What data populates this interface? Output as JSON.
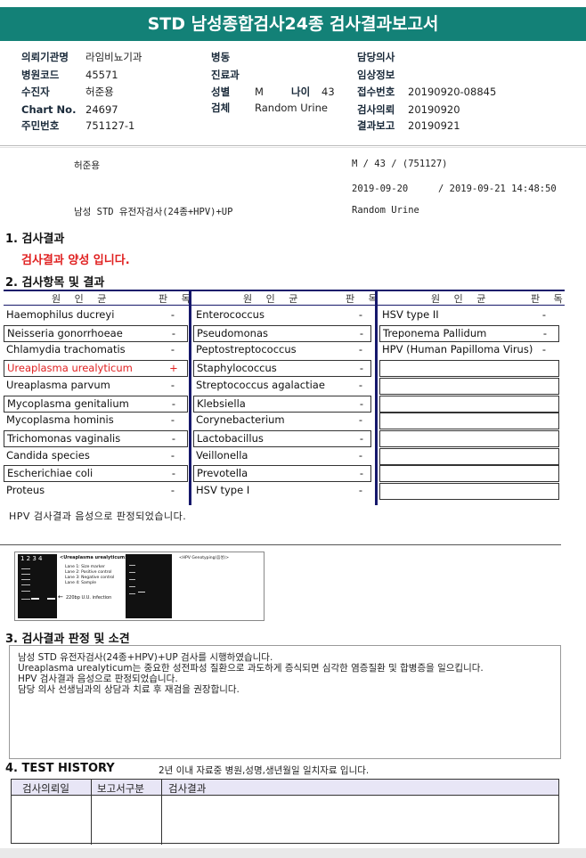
{
  "title": "STD 남성종합검사24종 검사결과보고서",
  "header": {
    "c1": [
      {
        "label": "의뢰기관명",
        "value": "라임비뇨기과"
      },
      {
        "label": "병원코드",
        "value": "45571"
      },
      {
        "label": "수진자",
        "value": "허준용"
      },
      {
        "label": "Chart No.",
        "value": "24697"
      },
      {
        "label": "주민번호",
        "value": "751127-1"
      }
    ],
    "c2": [
      {
        "label": "병동",
        "value": ""
      },
      {
        "label": "진료과",
        "value": ""
      },
      {
        "label": "성별",
        "value": "M"
      },
      {
        "label": "검체",
        "value": "Random Urine"
      }
    ],
    "age_label": "나이",
    "age_value": "43",
    "c3": [
      {
        "label": "담당의사",
        "value": ""
      },
      {
        "label": "임상정보",
        "value": ""
      },
      {
        "label": "접수번호",
        "value": "20190920-08845"
      },
      {
        "label": "검사의뢰",
        "value": "20190920"
      },
      {
        "label": "결과보고",
        "value": "20190921"
      }
    ]
  },
  "summary": {
    "name": "허준용",
    "sex_age": "M /    43 / (751127)",
    "date_from": "2019-09-20",
    "date_to": "/  2019-09-21 14:48:50",
    "test_name": "남성 STD 유전자검사(24종+HPV)+UP",
    "specimen": "Random Urine"
  },
  "section1": {
    "title": "1. 검사결과",
    "result": "검사결과 양성 입니다."
  },
  "section2": {
    "title": "2. 검사항목 및 결과",
    "col_header_name": "원 인 균",
    "col_header_result": "판 독",
    "columns": [
      [
        {
          "name": "Haemophilus ducreyi",
          "result": "-",
          "positive": false
        },
        {
          "name": "Neisseria gonorrhoeae",
          "result": "-",
          "positive": false
        },
        {
          "name": "Chlamydia trachomatis",
          "result": "-",
          "positive": false
        },
        {
          "name": "Ureaplasma urealyticum",
          "result": "+",
          "positive": true
        },
        {
          "name": "Ureaplasma parvum",
          "result": "-",
          "positive": false
        },
        {
          "name": "Mycoplasma genitalium",
          "result": "-",
          "positive": false
        },
        {
          "name": "Mycoplasma hominis",
          "result": "-",
          "positive": false
        },
        {
          "name": "Trichomonas vaginalis",
          "result": "-",
          "positive": false
        },
        {
          "name": "Candida species",
          "result": "-",
          "positive": false
        },
        {
          "name": "Escherichiae coli",
          "result": "-",
          "positive": false
        },
        {
          "name": "Proteus",
          "result": "-",
          "positive": false
        }
      ],
      [
        {
          "name": "Enterococcus",
          "result": "-",
          "positive": false
        },
        {
          "name": "Pseudomonas",
          "result": "-",
          "positive": false
        },
        {
          "name": "Peptostreptococcus",
          "result": "-",
          "positive": false
        },
        {
          "name": "Staphylococcus",
          "result": "-",
          "positive": false
        },
        {
          "name": "Streptococcus agalactiae",
          "result": "-",
          "positive": false
        },
        {
          "name": "Klebsiella",
          "result": "-",
          "positive": false
        },
        {
          "name": "Corynebacterium",
          "result": "-",
          "positive": false
        },
        {
          "name": "Lactobacillus",
          "result": "-",
          "positive": false
        },
        {
          "name": "Veillonella",
          "result": "-",
          "positive": false
        },
        {
          "name": "Prevotella",
          "result": "-",
          "positive": false
        },
        {
          "name": "HSV type I",
          "result": "-",
          "positive": false
        }
      ],
      [
        {
          "name": "HSV type II",
          "result": "-",
          "positive": false
        },
        {
          "name": "Treponema Pallidum",
          "result": "-",
          "positive": false
        },
        {
          "name": "HPV (Human Papilloma Virus)",
          "result": "-",
          "positive": false
        },
        {
          "name": "",
          "result": "",
          "positive": false
        },
        {
          "name": "",
          "result": "",
          "positive": false
        },
        {
          "name": "",
          "result": "",
          "positive": false
        },
        {
          "name": "",
          "result": "",
          "positive": false
        },
        {
          "name": "",
          "result": "",
          "positive": false
        },
        {
          "name": "",
          "result": "",
          "positive": false
        },
        {
          "name": "",
          "result": "",
          "positive": false
        },
        {
          "name": "",
          "result": "",
          "positive": false
        }
      ]
    ],
    "hpv_note": "HPV 검사결과 음성으로 판정되었습니다."
  },
  "gel": {
    "lane_numbers": "1  2  3  4",
    "title": "<Ureaplasma urealyticum>",
    "legend": [
      "Lane 1: Size marker",
      "Lane 2: Positive control",
      "Lane 3: Negative control",
      "Lane 4: Sample"
    ],
    "arrow_label": "220bp U.U. infection",
    "hpv_title": "<HPV Genotyping(음성)>"
  },
  "section3": {
    "title": "3. 검사결과 판정 및 소견",
    "lines": [
      "남성 STD 유전자검사(24종+HPV)+UP 검사를 시행하였습니다.",
      "Ureaplasma urealyticum는 중요한 성전파성 질환으로 과도하게 증식되면 심각한 염증질환 및 합병증을 일으킵니다.",
      "HPV 검사결과 음성으로 판정되었습니다.",
      "담당 의사 선생님과의 상담과 치료 후 재검을 권장합니다."
    ]
  },
  "section4": {
    "title": "4. TEST HISTORY",
    "note": "2년 이내 자료중 병원,성명,생년월일 일치자료 입니다.",
    "headers": [
      "검사의뢰일",
      "보고서구분",
      "검사결과"
    ]
  },
  "colors": {
    "title_bg": "#138177",
    "positive": "#e02020",
    "rule": "#16186b"
  }
}
